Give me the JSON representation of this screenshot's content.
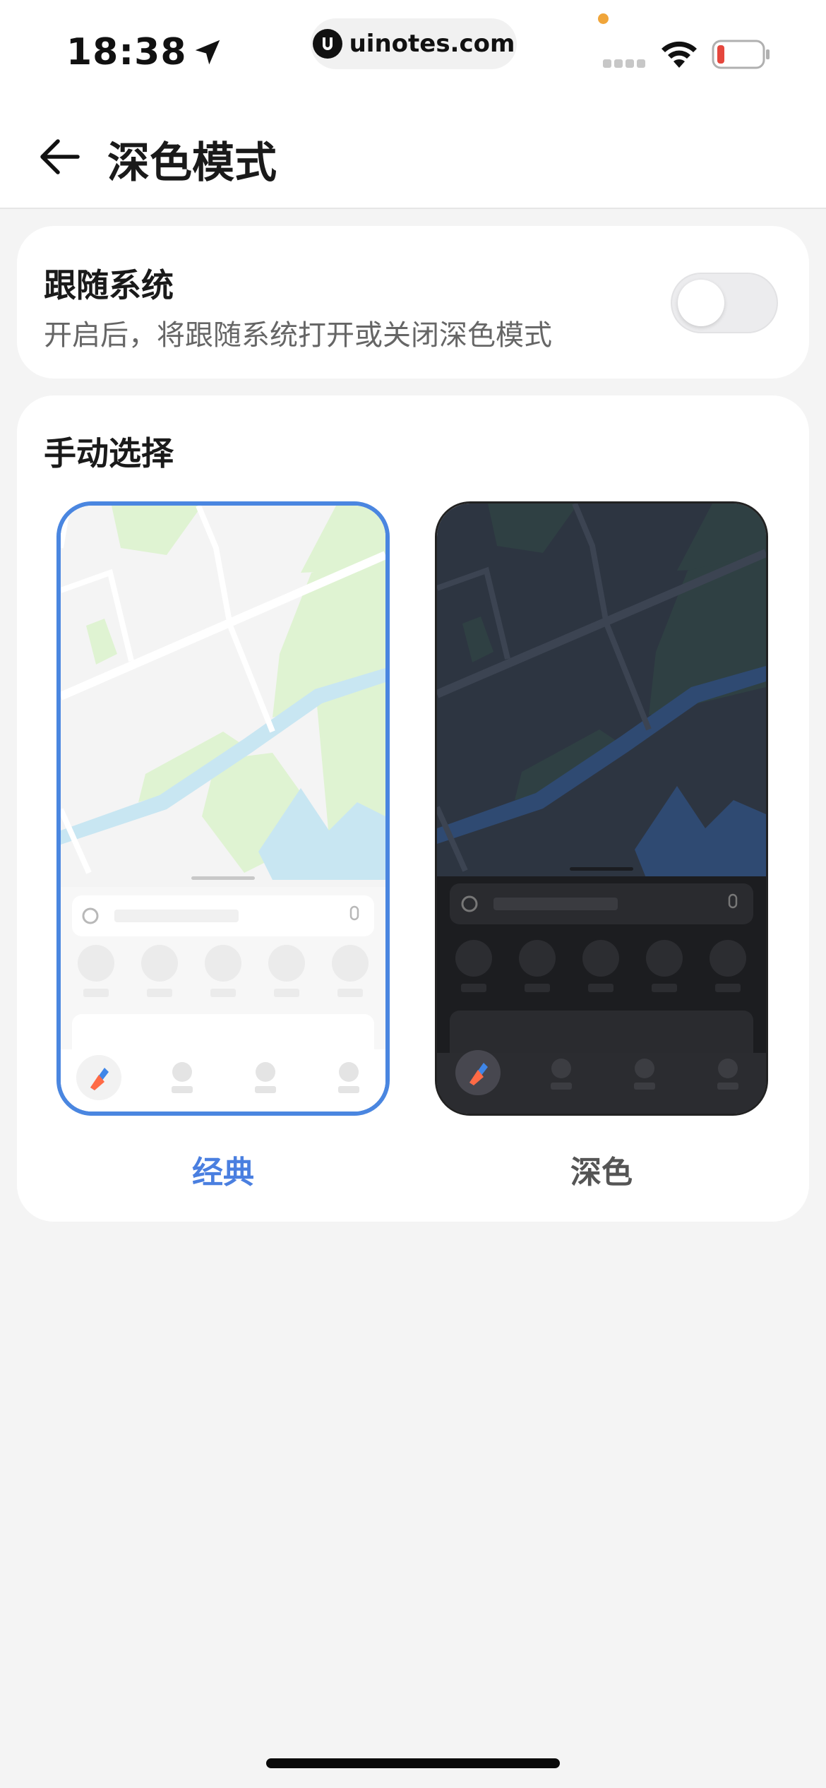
{
  "status_bar": {
    "time": "18:38",
    "url": "uinotes.com"
  },
  "header": {
    "title": "深色模式"
  },
  "follow_system": {
    "title": "跟随系统",
    "description": "开启后，将跟随系统打开或关闭深色模式",
    "enabled": false
  },
  "manual_select": {
    "title": "手动选择",
    "options": [
      {
        "label": "经典",
        "selected": true
      },
      {
        "label": "深色",
        "selected": false
      }
    ]
  },
  "colors": {
    "accent": "#4a7fe0",
    "label_inactive": "#555555",
    "light_map_bg": "#f4f4f4",
    "light_map_park": "#dff3d2",
    "light_map_water": "#c8e6f2",
    "dark_map_bg": "#2d3541",
    "dark_map_water": "#2f4a72",
    "dark_panel": "#1c1d20"
  }
}
